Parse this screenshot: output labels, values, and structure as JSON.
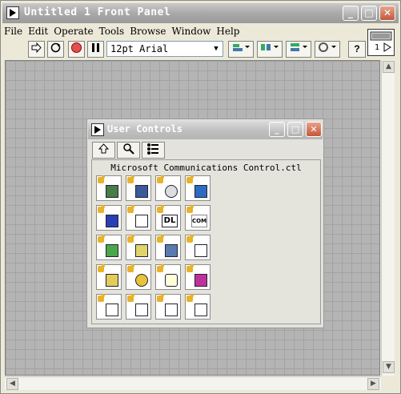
{
  "window": {
    "title": "Untitled 1 Front Panel"
  },
  "title_buttons": {
    "minimize": "_",
    "maximize": "□",
    "close": "✕"
  },
  "menu": [
    "File",
    "Edit",
    "Operate",
    "Tools",
    "Browse",
    "Window",
    "Help"
  ],
  "toolbar": {
    "run_icon": "run-arrow-icon",
    "run_continuous_icon": "run-continuous-icon",
    "abort_icon": "abort-icon",
    "pause_icon": "pause-icon",
    "font": "12pt Arial",
    "help_label": "?"
  },
  "connector_pane": {
    "label": "1"
  },
  "palette": {
    "title": "User Controls",
    "tools": [
      "up-arrow-icon",
      "search-icon",
      "options-icon"
    ],
    "file": "Microsoft Communications Control.ctl",
    "icon_labels": {
      "dl": "DL",
      "com": "COM"
    }
  },
  "colors": {
    "grid": "#b4b4b4",
    "accent_puzzle": "#e8b32a",
    "close": "#c1583d"
  }
}
